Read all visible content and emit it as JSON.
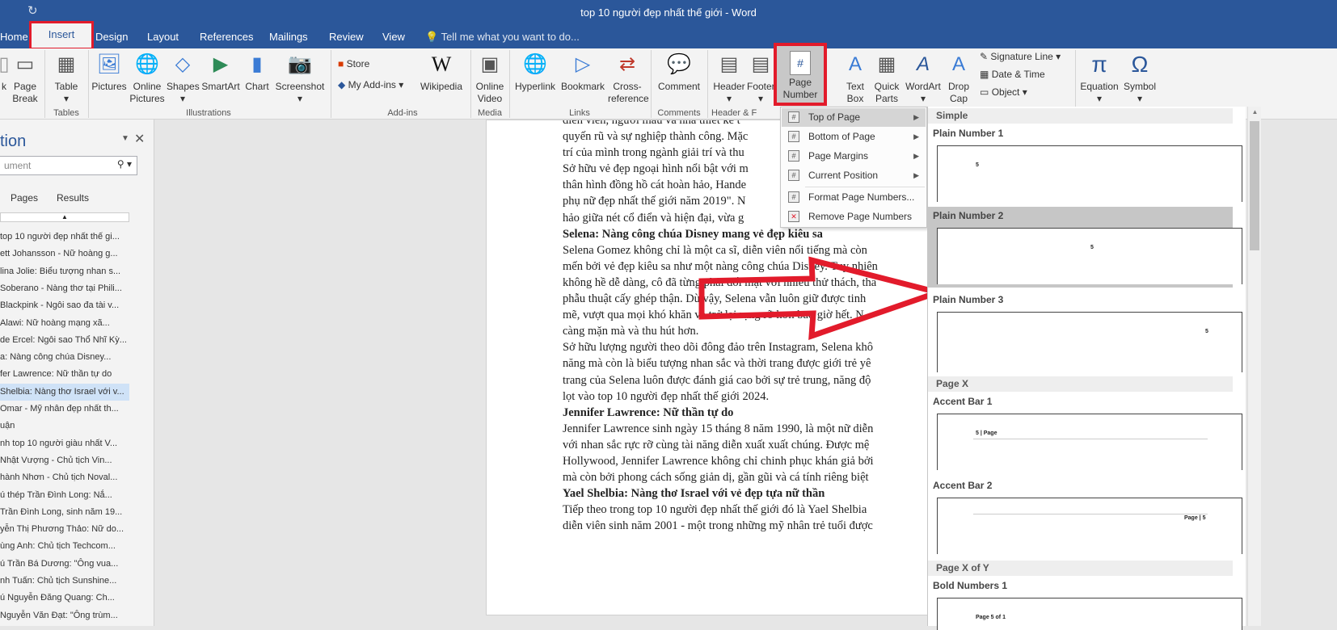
{
  "window": {
    "title": "top 10 người đẹp nhất thế giới - Word"
  },
  "tabs": [
    "Home",
    "Insert",
    "Design",
    "Layout",
    "References",
    "Mailings",
    "Review",
    "View"
  ],
  "tell_me": "Tell me what you want to do...",
  "ribbon": {
    "page_break": "Page Break",
    "table": "Table",
    "pictures": "Pictures",
    "online_pictures": "Online Pictures",
    "shapes": "Shapes",
    "smartart": "SmartArt",
    "chart": "Chart",
    "screenshot": "Screenshot",
    "store": "Store",
    "my_addins": "My Add-ins",
    "wikipedia": "Wikipedia",
    "online_video": "Online Video",
    "hyperlink": "Hyperlink",
    "bookmark": "Bookmark",
    "cross_reference": "Cross-reference",
    "comment": "Comment",
    "header": "Header",
    "footer": "Footer",
    "page_number": "Page Number",
    "text_box": "Text Box",
    "quick_parts": "Quick Parts",
    "wordart": "WordArt",
    "drop_cap": "Drop Cap",
    "signature_line": "Signature Line",
    "date_time": "Date & Time",
    "object": "Object",
    "equation": "Equation",
    "symbol": "Symbol",
    "groups": {
      "tables": "Tables",
      "illustrations": "Illustrations",
      "addins": "Add-ins",
      "media": "Media",
      "links": "Links",
      "comments": "Comments",
      "header_footer": "Header & F"
    }
  },
  "nav": {
    "title": "tion",
    "search_placeholder": "ument",
    "tabs": [
      "Pages",
      "Results"
    ],
    "items": [
      "top 10 người đẹp nhất thế gi...",
      "ett Johansson - Nữ hoàng g...",
      "lina Jolie: Biểu tượng nhan s...",
      "Soberano - Nàng thơ tại Phili...",
      "Blackpink - Ngôi sao đa tài v...",
      "Alawi: Nữ hoàng mạng xã...",
      "de Ercel: Ngôi sao Thổ Nhĩ Kỳ...",
      "a: Nàng công chúa Disney...",
      "fer Lawrence: Nữ thần tự do",
      "Shelbia: Nàng thơ Israel với v...",
      "Omar - Mỹ nhân đẹp nhất th...",
      "uận",
      "nh top 10 người giàu nhất V...",
      "Nhật Vượng - Chủ tịch Vin...",
      "hành Nhơn - Chủ tịch Noval...",
      "ú thép Trần Đình Long: Nắ...",
      "Trần Đình Long, sinh năm 19...",
      "yễn Thị Phương Thảo: Nữ do...",
      "ùng Anh: Chủ tịch Techcom...",
      "ú Trần Bá Dương: \"Ông vua...",
      "nh Tuấn: Chủ tịch Sunshine...",
      "ú Nguyễn Đăng Quang: Ch...",
      "Nguyễn Văn Đạt: \"Ông trùm..."
    ]
  },
  "document": {
    "lines": [
      "diễn viên, người mẫu và nhà thiết kế t",
      "quyến rũ và sự nghiệp thành công. Mặc",
      "trí của mình trong ngành giải trí và thu",
      "Sở hữu vẻ đẹp ngoại hình nổi bật với m",
      "thân hình đồng hồ cát hoàn hảo, Hande",
      "phụ nữ đẹp nhất thế giới năm 2019\". N",
      "hảo giữa nét cổ điển và hiện đại, vừa g"
    ],
    "heading_selena": "Selena: Nàng công chúa Disney mang vẻ đẹp kiêu sa",
    "selena_lines": [
      "Selena Gomez không chỉ là một ca sĩ, diễn viên nổi tiếng mà còn",
      "mến bởi vẻ đẹp kiêu sa như một nàng công chúa Disney. Tuy nhiên",
      "không hề dễ dàng, cô đã từng phải đối mặt với nhiều thử thách, tha",
      "phẫu thuật cấy ghép thận. Dù vậy, Selena vẫn luôn giữ được tinh",
      "mẽ, vượt qua mọi khó khăn và trở lại rạng rỡ hơn bao giờ hết. N",
      "càng mặn mà và thu hút hơn.",
      "Sở hữu lượng người theo dõi đông đảo trên Instagram, Selena khô",
      "năng mà còn là biểu tượng nhan sắc và thời trang được giới trẻ yê",
      "trang của Selena luôn được đánh giá cao bởi sự trẻ trung, năng độ",
      "lọt vào top 10 người đẹp nhất thế giới 2024."
    ],
    "heading_jennifer": "Jennifer Lawrence: Nữ thần tự do",
    "jennifer_lines": [
      "Jennifer Lawrence sinh ngày 15 tháng 8 năm 1990, là một nữ diễn",
      "với nhan sắc rực rỡ cùng tài năng diễn xuất xuất chúng. Được mệ",
      "Hollywood, Jennifer Lawrence không chỉ chinh phục khán giả bởi",
      "mà còn bởi phong cách sống giản dị, gần gũi và cá tính riêng biệt"
    ],
    "heading_yael": "Yael Shelbia: Nàng thơ Israel với vẻ đẹp tựa nữ thần",
    "yael_lines": [
      "Tiếp theo trong top 10 người đẹp nhất thế giới đó là Yael Shelbia",
      "diễn viên sinh năm 2001 - một trong những mỹ nhân trẻ tuổi được"
    ]
  },
  "page_number_menu": {
    "items": [
      "Top of Page",
      "Bottom of Page",
      "Page Margins",
      "Current Position",
      "Format Page Numbers...",
      "Remove Page Numbers"
    ]
  },
  "gallery": {
    "sections": {
      "simple": "Simple",
      "page_x": "Page X",
      "page_x_of_y": "Page X of Y"
    },
    "labels": [
      "Plain Number 1",
      "Plain Number 2",
      "Plain Number 3",
      "Accent Bar 1",
      "Accent Bar 2",
      "Bold Numbers 1"
    ],
    "thumb_texts": {
      "plain1": "5",
      "plain2": "5",
      "plain3": "5",
      "accent1": "5 | Page",
      "accent2": "Page | 5",
      "bold1": "Page 5 of 1"
    }
  },
  "colors": {
    "accent": "#2b579a",
    "highlight_box": "#e21b2b",
    "arrow": "#e21b2b"
  }
}
